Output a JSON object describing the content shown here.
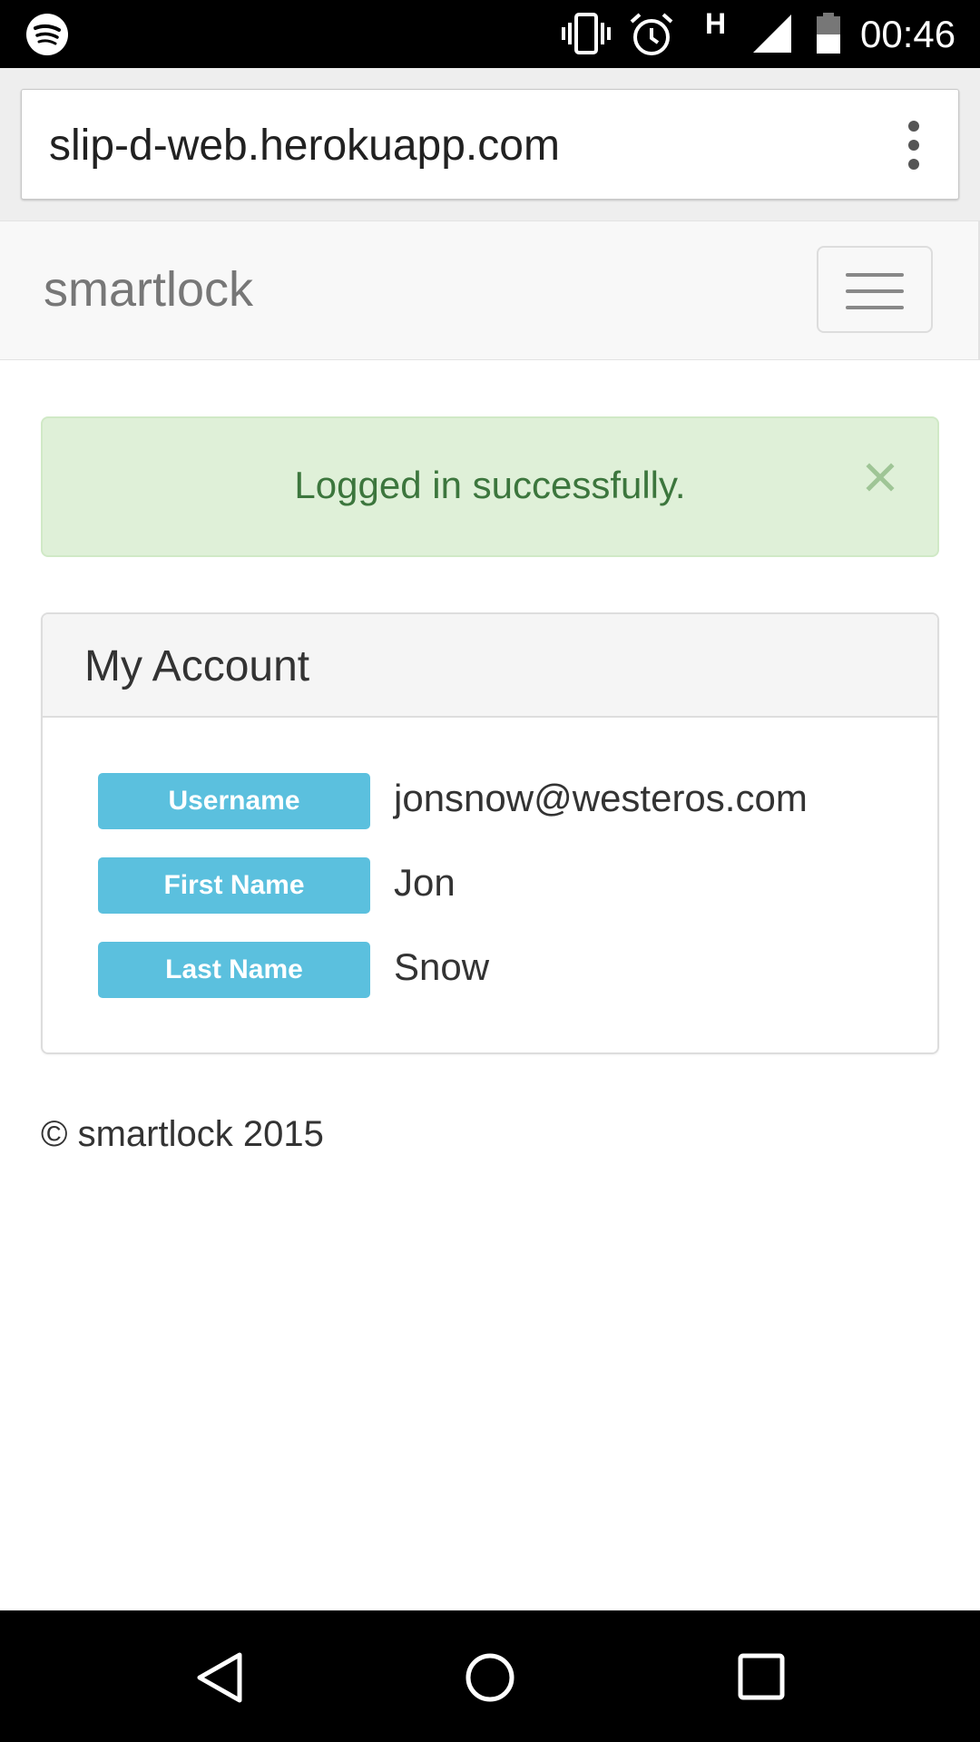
{
  "status_bar": {
    "time": "00:46",
    "network_type": "H",
    "icons": [
      "spotify-icon",
      "vibrate-icon",
      "alarm-icon",
      "network-h-icon",
      "signal-icon",
      "battery-icon"
    ]
  },
  "browser": {
    "url": "slip-d-web.herokuapp.com",
    "menu_icon": "more-vert-icon"
  },
  "navbar": {
    "brand": "smartlock",
    "toggle_icon": "hamburger-icon"
  },
  "alert": {
    "message": "Logged in successfully.",
    "close_glyph": "×",
    "colors": {
      "background": "#dff0d8",
      "text": "#3c763d",
      "border": "#d0e9c6"
    }
  },
  "account": {
    "title": "My Account",
    "fields": [
      {
        "label": "Username",
        "value": "jonsnow@westeros.com"
      },
      {
        "label": "First Name",
        "value": "Jon"
      },
      {
        "label": "Last Name",
        "value": "Snow"
      }
    ],
    "label_color": "#5bc0de"
  },
  "footer": {
    "copyright": "© smartlock 2015"
  },
  "system_nav": {
    "icons": [
      "back-icon",
      "home-icon",
      "recents-icon"
    ]
  }
}
